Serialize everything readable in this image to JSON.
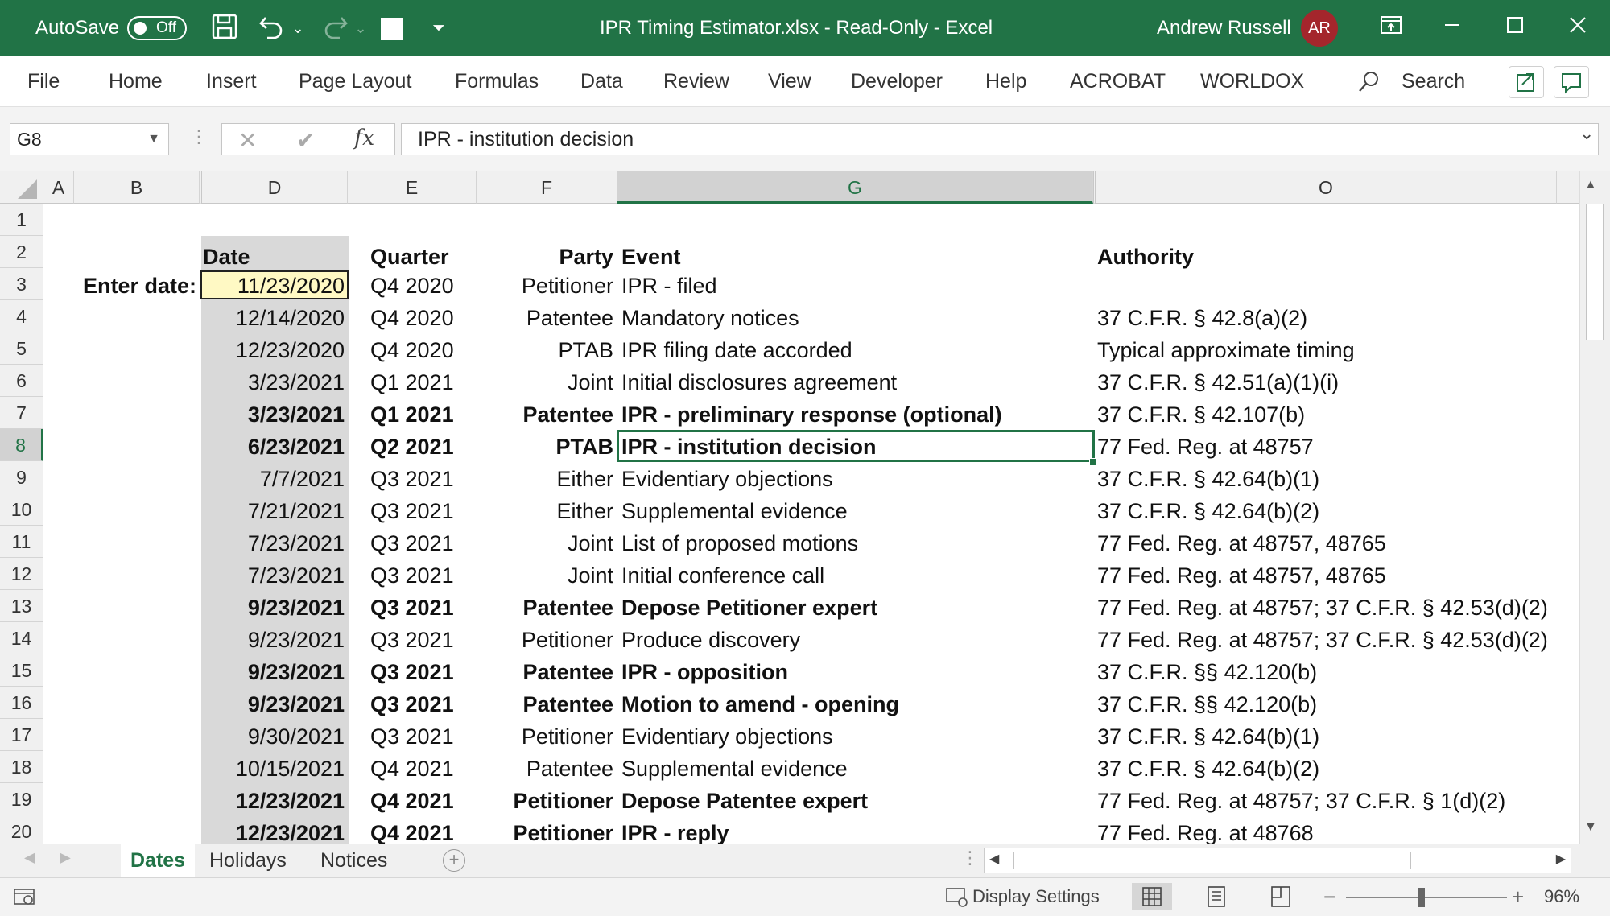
{
  "titlebar": {
    "autosave_label": "AutoSave",
    "autosave_state": "Off",
    "title": "IPR Timing Estimator.xlsx  -  Read-Only  -  Excel",
    "user_name": "Andrew Russell",
    "user_initials": "AR"
  },
  "ribbon": {
    "tabs": [
      "File",
      "Home",
      "Insert",
      "Page Layout",
      "Formulas",
      "Data",
      "Review",
      "View",
      "Developer",
      "Help",
      "ACROBAT",
      "WORLDOX"
    ],
    "search_label": "Search"
  },
  "formula_bar": {
    "name_box": "G8",
    "content": "IPR - institution decision"
  },
  "columns": [
    "A",
    "B",
    "D",
    "E",
    "F",
    "G",
    "O"
  ],
  "selected_column": "G",
  "rows": [
    "1",
    "2",
    "3",
    "4",
    "5",
    "6",
    "7",
    "8",
    "9",
    "10",
    "11",
    "12",
    "13",
    "14",
    "15",
    "16",
    "17",
    "18",
    "19",
    "20"
  ],
  "selected_row": "8",
  "headers": {
    "date": "Date",
    "quarter": "Quarter",
    "party": "Party",
    "event": "Event",
    "authority": "Authority"
  },
  "enter_date_label": "Enter date:",
  "table": [
    {
      "row": "3",
      "date": "11/23/2020",
      "quarter": "Q4 2020",
      "party": "Petitioner",
      "event": "IPR - filed",
      "authority": "",
      "bold": false
    },
    {
      "row": "4",
      "date": "12/14/2020",
      "quarter": "Q4 2020",
      "party": "Patentee",
      "event": "Mandatory notices",
      "authority": "37 C.F.R. § 42.8(a)(2)",
      "bold": false
    },
    {
      "row": "5",
      "date": "12/23/2020",
      "quarter": "Q4 2020",
      "party": "PTAB",
      "event": "IPR filing date accorded",
      "authority": "Typical approximate timing",
      "bold": false
    },
    {
      "row": "6",
      "date": "3/23/2021",
      "quarter": "Q1 2021",
      "party": "Joint",
      "event": "Initial disclosures agreement",
      "authority": "37 C.F.R. § 42.51(a)(1)(i)",
      "bold": false
    },
    {
      "row": "7",
      "date": "3/23/2021",
      "quarter": "Q1 2021",
      "party": "Patentee",
      "event": "IPR - preliminary response (optional)",
      "authority": "37 C.F.R. § 42.107(b)",
      "bold": true
    },
    {
      "row": "8",
      "date": "6/23/2021",
      "quarter": "Q2 2021",
      "party": "PTAB",
      "event": "IPR - institution decision",
      "authority": "77 Fed. Reg. at 48757",
      "bold": true
    },
    {
      "row": "9",
      "date": "7/7/2021",
      "quarter": "Q3 2021",
      "party": "Either",
      "event": "Evidentiary objections",
      "authority": "37 C.F.R. § 42.64(b)(1)",
      "bold": false
    },
    {
      "row": "10",
      "date": "7/21/2021",
      "quarter": "Q3 2021",
      "party": "Either",
      "event": "Supplemental evidence",
      "authority": "37 C.F.R. § 42.64(b)(2)",
      "bold": false
    },
    {
      "row": "11",
      "date": "7/23/2021",
      "quarter": "Q3 2021",
      "party": "Joint",
      "event": "List of proposed motions",
      "authority": "77 Fed. Reg. at 48757, 48765",
      "bold": false
    },
    {
      "row": "12",
      "date": "7/23/2021",
      "quarter": "Q3 2021",
      "party": "Joint",
      "event": "Initial conference call",
      "authority": "77 Fed. Reg. at 48757, 48765",
      "bold": false
    },
    {
      "row": "13",
      "date": "9/23/2021",
      "quarter": "Q3 2021",
      "party": "Patentee",
      "event": "Depose Petitioner expert",
      "authority": "77 Fed. Reg. at 48757; 37 C.F.R. § 42.53(d)(2)",
      "bold": true
    },
    {
      "row": "14",
      "date": "9/23/2021",
      "quarter": "Q3 2021",
      "party": "Petitioner",
      "event": "Produce discovery",
      "authority": "77 Fed. Reg. at 48757; 37 C.F.R. § 42.53(d)(2)",
      "bold": false
    },
    {
      "row": "15",
      "date": "9/23/2021",
      "quarter": "Q3 2021",
      "party": "Patentee",
      "event": "IPR - opposition",
      "authority": "37 C.F.R. §§ 42.120(b)",
      "bold": true
    },
    {
      "row": "16",
      "date": "9/23/2021",
      "quarter": "Q3 2021",
      "party": "Patentee",
      "event": "Motion to amend - opening",
      "authority": "37 C.F.R. §§ 42.120(b)",
      "bold": true
    },
    {
      "row": "17",
      "date": "9/30/2021",
      "quarter": "Q3 2021",
      "party": "Petitioner",
      "event": "Evidentiary objections",
      "authority": "37 C.F.R. § 42.64(b)(1)",
      "bold": false
    },
    {
      "row": "18",
      "date": "10/15/2021",
      "quarter": "Q4 2021",
      "party": "Patentee",
      "event": "Supplemental evidence",
      "authority": "37 C.F.R. § 42.64(b)(2)",
      "bold": false
    },
    {
      "row": "19",
      "date": "12/23/2021",
      "quarter": "Q4 2021",
      "party": "Petitioner",
      "event": "Depose Patentee expert",
      "authority": "77 Fed. Reg. at 48757; 37 C.F.R. § 1(d)(2)",
      "bold": true
    },
    {
      "row": "20",
      "date": "12/23/2021",
      "quarter": "Q4 2021",
      "party": "Petitioner",
      "event": "IPR - reply",
      "authority": "77 Fed. Reg. at 48768",
      "bold": true
    }
  ],
  "sheet_tabs": [
    "Dates",
    "Holidays",
    "Notices"
  ],
  "active_sheet": "Dates",
  "statusbar": {
    "display_settings": "Display Settings",
    "zoom": "96%"
  },
  "colors": {
    "excel_green": "#217346",
    "input_fill": "#fff9c4",
    "date_column_fill": "#d9d9d9",
    "avatar": "#a4262c"
  },
  "icons": [
    "save-icon",
    "undo-icon",
    "redo-icon",
    "customize-icon",
    "ribbon-display-icon",
    "minimize-icon",
    "maximize-icon",
    "close-icon",
    "search-icon",
    "share-icon",
    "comments-icon",
    "fx-icon",
    "cancel-icon",
    "enter-icon",
    "add-sheet-icon",
    "macro-record-icon",
    "normal-view-icon",
    "page-layout-view-icon",
    "page-break-view-icon"
  ]
}
